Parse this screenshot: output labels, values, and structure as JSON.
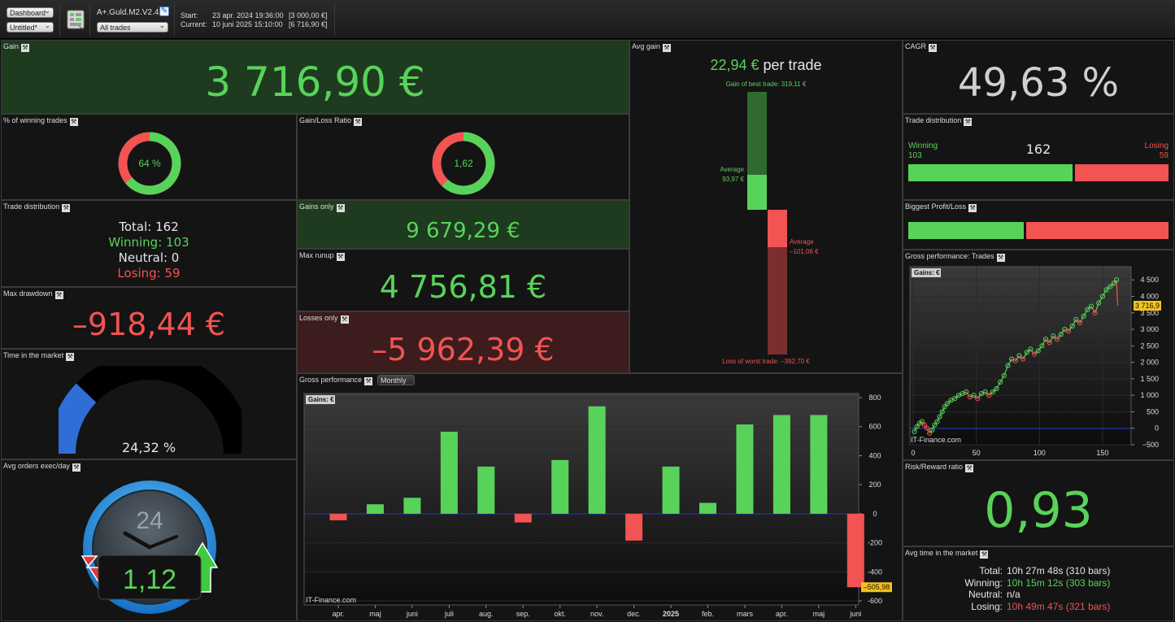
{
  "toolbar": {
    "dashboard_select": "Dashboard",
    "untitled_select": "Untitled*",
    "strategy_name": "A+.Guld.M2.V2.4",
    "trades_select": "All trades",
    "start_label": "Start:",
    "start_value": "23 apr. 2024 19:36:00",
    "start_amount": "[3 000,00 €]",
    "current_label": "Current:",
    "current_value": "10 juni 2025 15:10:00",
    "current_amount": "[6 716,90 €]"
  },
  "gain": {
    "title": "Gain",
    "value": "3 716,90 €"
  },
  "winning_pct": {
    "title": "% of winning trades",
    "value": "64 %",
    "fraction": 0.64
  },
  "gain_loss_ratio": {
    "title": "Gain/Loss Ratio",
    "value": "1,62",
    "fraction": 0.62
  },
  "trade_dist_left": {
    "title": "Trade distribution",
    "total": "Total: 162",
    "winning": "Winning: 103",
    "neutral": "Neutral: 0",
    "losing": "Losing: 59"
  },
  "gains_only": {
    "title": "Gains only",
    "value": "9 679,29 €"
  },
  "max_runup": {
    "title": "Max runup",
    "value": "4 756,81 €"
  },
  "max_drawdown": {
    "title": "Max drawdown",
    "value": "–918,44 €"
  },
  "losses_only": {
    "title": "Losses only",
    "value": "–5 962,39 €"
  },
  "time_in_market": {
    "title": "Time in the market",
    "value": "24,32 %",
    "fraction": 0.2432
  },
  "avg_orders": {
    "title": "Avg orders exec/day",
    "value": "1,12",
    "clock_label": "24"
  },
  "avg_gain": {
    "title": "Avg gain",
    "value": "22,94 €",
    "suffix": "per trade",
    "best_label": "Gain of best trade: 319,11 €",
    "avg_win_label": "Average",
    "avg_win_value": "93,97 €",
    "avg_loss_label": "Average",
    "avg_loss_value": "–101,06 €",
    "worst_label": "Loss of worst trade: –392,70 €",
    "best": 319.11,
    "avg_win": 93.97,
    "avg_loss": -101.06,
    "worst": -392.7
  },
  "cagr": {
    "title": "CAGR",
    "value": "49,63 %"
  },
  "trade_dist_right": {
    "title": "Trade distribution",
    "winning_label": "Winning",
    "winning_value": "103",
    "total": "162",
    "losing_label": "Losing",
    "losing_value": "59",
    "win_fraction": 0.636
  },
  "biggest_pl": {
    "title": "Biggest Profit/Loss",
    "profit": 319.11,
    "loss": 392.7
  },
  "gross_perf_trades": {
    "title": "Gross performance: Trades",
    "gains_tag": "Gains: €",
    "last_value_label": "3 716,9",
    "watermark": "IT-Finance.com"
  },
  "risk_reward": {
    "title": "Risk/Reward ratio",
    "value": "0,93"
  },
  "avg_time": {
    "title": "Avg time in the market",
    "rows": [
      {
        "label": "Total:",
        "value": "10h 27m 48s (310 bars)"
      },
      {
        "label": "Winning:",
        "value": "10h 15m 12s (303 bars)"
      },
      {
        "label": "Neutral:",
        "value": "n/a"
      },
      {
        "label": "Losing:",
        "value": "10h 49m 47s (321 bars)"
      }
    ]
  },
  "gross_perf": {
    "title": "Gross performance",
    "period_select": "Monthly",
    "gains_tag": "Gains: €",
    "last_value_label": "–505,98",
    "watermark": "IT-Finance.com"
  },
  "colors": {
    "green": "#58d35a",
    "red": "#f25353",
    "panel_green": "#1f3b1f",
    "panel_red": "#3c1c1c",
    "zero_line": "#2233aa"
  },
  "chart_data": [
    {
      "type": "bar",
      "title": "Gross performance",
      "categories": [
        "apr.",
        "maj",
        "juni",
        "juli",
        "aug.",
        "sep.",
        "okt.",
        "nov.",
        "dec.",
        "2025",
        "feb.",
        "mars",
        "apr.",
        "maj",
        "juni"
      ],
      "values": [
        -45,
        65,
        110,
        565,
        325,
        -60,
        370,
        740,
        -185,
        325,
        75,
        615,
        680,
        680,
        -505.98
      ],
      "ylim": [
        -600,
        800
      ],
      "yticks": [
        800,
        600,
        400,
        200,
        0,
        -200,
        -400,
        -600
      ],
      "grid": true
    },
    {
      "type": "line",
      "title": "Gross performance: Trades",
      "x": [
        1,
        3,
        5,
        7,
        9,
        11,
        13,
        15,
        17,
        19,
        21,
        23,
        25,
        27,
        30,
        33,
        36,
        39,
        42,
        45,
        48,
        51,
        54,
        57,
        60,
        63,
        66,
        69,
        72,
        75,
        78,
        81,
        84,
        87,
        90,
        93,
        96,
        99,
        102,
        105,
        108,
        111,
        114,
        117,
        120,
        123,
        126,
        129,
        132,
        135,
        138,
        141,
        144,
        147,
        150,
        153,
        156,
        159,
        161,
        162
      ],
      "y": [
        -100,
        50,
        150,
        200,
        100,
        0,
        -150,
        -50,
        100,
        200,
        350,
        500,
        650,
        750,
        850,
        900,
        1000,
        1050,
        1100,
        950,
        1000,
        900,
        1050,
        1100,
        1000,
        1100,
        1200,
        1400,
        1600,
        1900,
        2100,
        2050,
        2200,
        2100,
        2300,
        2400,
        2250,
        2350,
        2500,
        2700,
        2600,
        2800,
        2700,
        2850,
        3000,
        2950,
        3100,
        3300,
        3200,
        3400,
        3600,
        3700,
        3500,
        3800,
        4000,
        4200,
        4300,
        4400,
        4500,
        3716.9
      ],
      "xticks": [
        0,
        50,
        100,
        150
      ],
      "yticks": [
        4500,
        4000,
        3500,
        3000,
        2500,
        2000,
        1500,
        1000,
        500,
        0,
        -500
      ],
      "xlim": [
        0,
        170
      ],
      "ylim": [
        -500,
        4900
      ],
      "grid": true
    }
  ]
}
